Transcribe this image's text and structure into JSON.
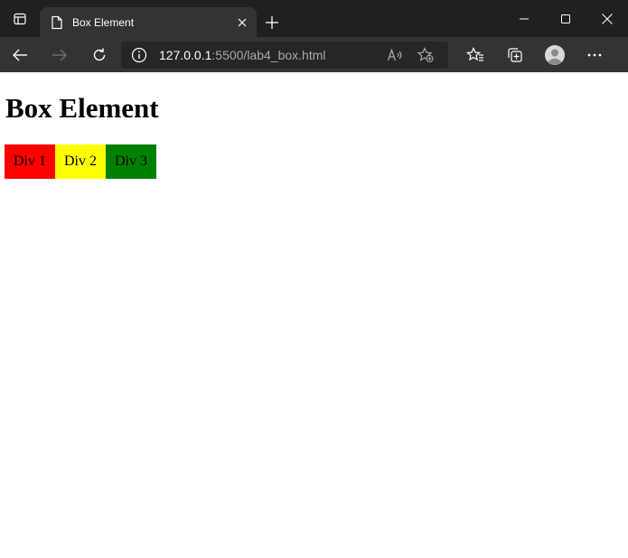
{
  "browser": {
    "tab": {
      "title": "Box Element",
      "favicon": "page-icon"
    },
    "address": {
      "host": "127.0.0.1",
      "path": ":5500/lab4_box.html"
    },
    "colors": {
      "tabstrip": "#202020",
      "toolbar": "#333333",
      "omnibox": "#262626"
    }
  },
  "page": {
    "heading": "Box Element",
    "boxes": [
      {
        "label": "Div 1",
        "color": "#ff0000"
      },
      {
        "label": "Div 2",
        "color": "#ffff00"
      },
      {
        "label": "Div 3",
        "color": "#008000"
      }
    ]
  }
}
